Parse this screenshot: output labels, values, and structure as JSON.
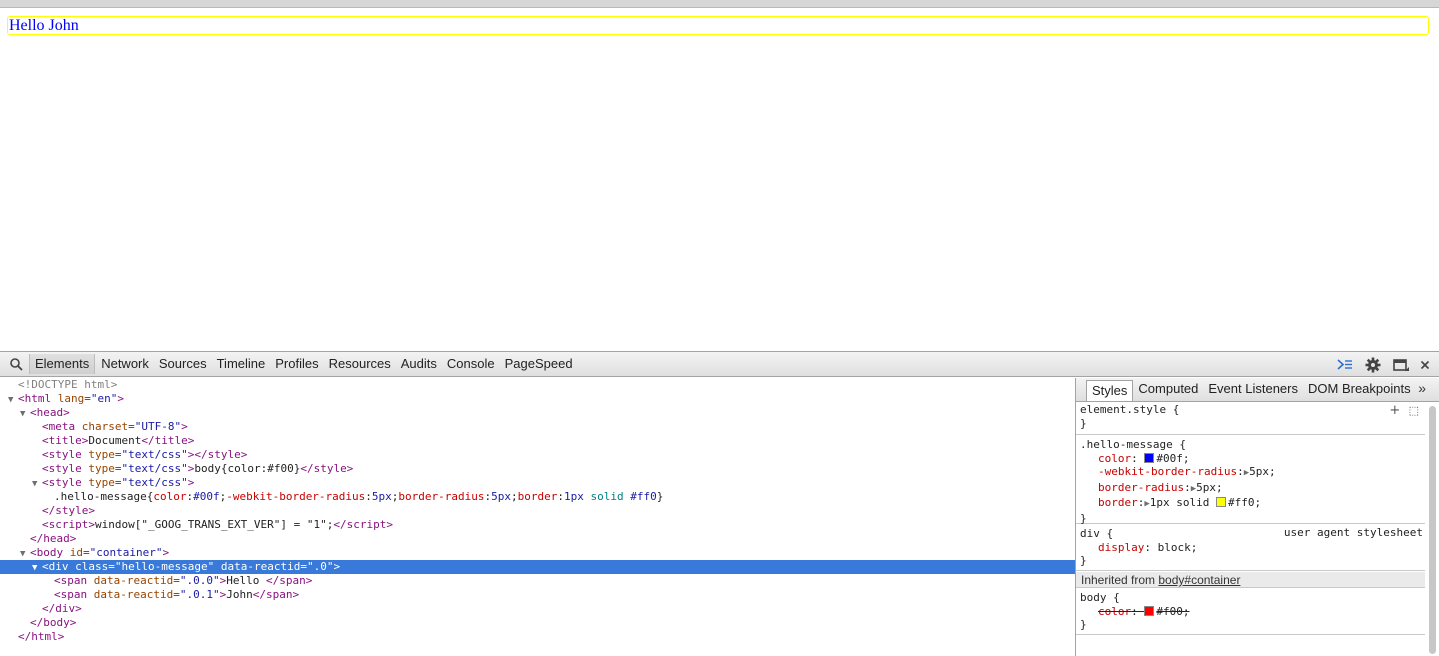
{
  "page": {
    "message_first": "Hello ",
    "message_last": "John"
  },
  "toolbar": {
    "search_icon": "search-icon",
    "tabs": [
      "Elements",
      "Network",
      "Sources",
      "Timeline",
      "Profiles",
      "Resources",
      "Audits",
      "Console",
      "PageSpeed"
    ],
    "active_tab": "Elements",
    "right_icons": [
      "console-drawer-icon",
      "gear-icon",
      "dock-icon",
      "close-icon"
    ]
  },
  "tree": {
    "doctype": "<!DOCTYPE html>",
    "html_open_tag": "html",
    "html_lang_attr": "lang",
    "html_lang_val": "\"en\"",
    "head": "head",
    "meta_attr": "charset",
    "meta_val": "\"UTF-8\"",
    "title_text": "Document",
    "style_type_attr": "type",
    "style_type_val": "\"text/css\"",
    "style2_content": "body{color:#f00}",
    "style3_selector": ".hello-message",
    "script_content": "window[\"_GOOG_TRANS_EXT_VER\"] = \"1\";",
    "body_id_val": "\"container\"",
    "div_class_val": "\"hello-message\"",
    "div_reactid_val": "\".0\"",
    "span1_reactid_val": "\".0.0\"",
    "span1_text": "Hello ",
    "span2_reactid_val": "\".0.1\"",
    "span2_text": "John"
  },
  "sidebar": {
    "tabs": [
      "Styles",
      "Computed",
      "Event Listeners",
      "DOM Breakpoints"
    ],
    "active_tab": "Styles",
    "element_style": "element.style {",
    "rule1_selector": ".hello-message {",
    "rule1_color_prop": "color",
    "rule1_color_val": "#00f;",
    "rule1_color_swatch": "#0000ff",
    "rule1_radius_webkit_prop": "-webkit-border-radius",
    "rule1_radius_webkit_val": "5px;",
    "rule1_radius_prop": "border-radius",
    "rule1_radius_val": "5px;",
    "rule1_border_prop": "border",
    "rule1_border_val_a": "1px solid ",
    "rule1_border_val_b": "#ff0;",
    "rule1_border_swatch": "#ffff00",
    "rule2_selector": "div {",
    "rule2_origin": "user agent stylesheet",
    "rule2_prop": "display",
    "rule2_val": "block;",
    "inherited_label": "Inherited from ",
    "inherited_link": "body#container",
    "rule3_selector": "body {",
    "rule3_prop": "color",
    "rule3_val": "#f00;",
    "rule3_swatch": "#ff0000",
    "close_brace": "}"
  }
}
